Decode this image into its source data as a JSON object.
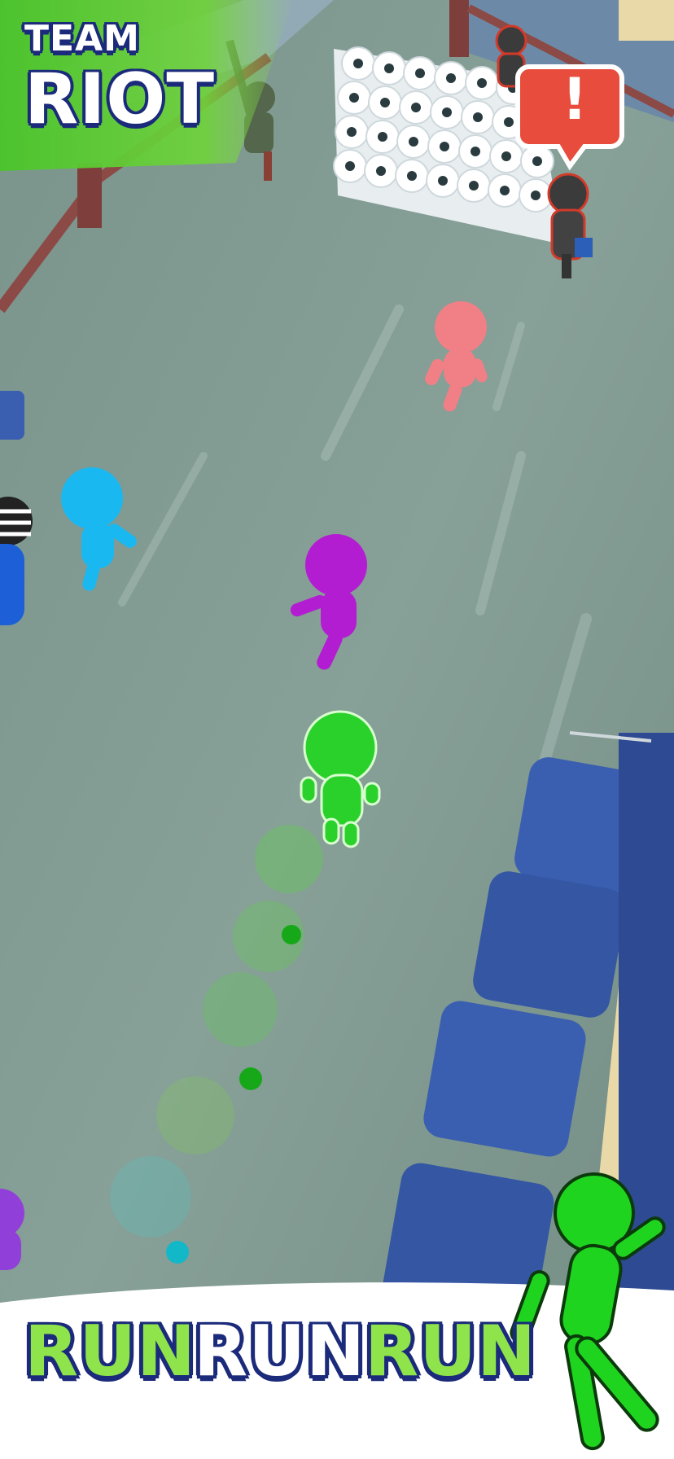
{
  "banner": {
    "line1": "TEAM",
    "line2": "RIOT"
  },
  "tagline": {
    "word1": "RUN",
    "word2": "RUN",
    "word3": "RUN"
  },
  "alert": {
    "symbol": "!"
  },
  "colors": {
    "floor": "#7f9890",
    "banner_green": "#4fc62f",
    "outline_navy": "#1b2a7a",
    "player_green": "#2bd12b",
    "pink_runner": "#f07f86",
    "cyan_runner": "#1ab8f0",
    "purple_runner": "#b31dd1",
    "seat_blue": "#3a5fb0",
    "alert_red": "#e84c3d"
  },
  "characters": [
    "player-green",
    "runner-pink",
    "runner-cyan",
    "runner-purple",
    "runner-blue-striped",
    "guard-left",
    "guard-right",
    "guard-top"
  ]
}
